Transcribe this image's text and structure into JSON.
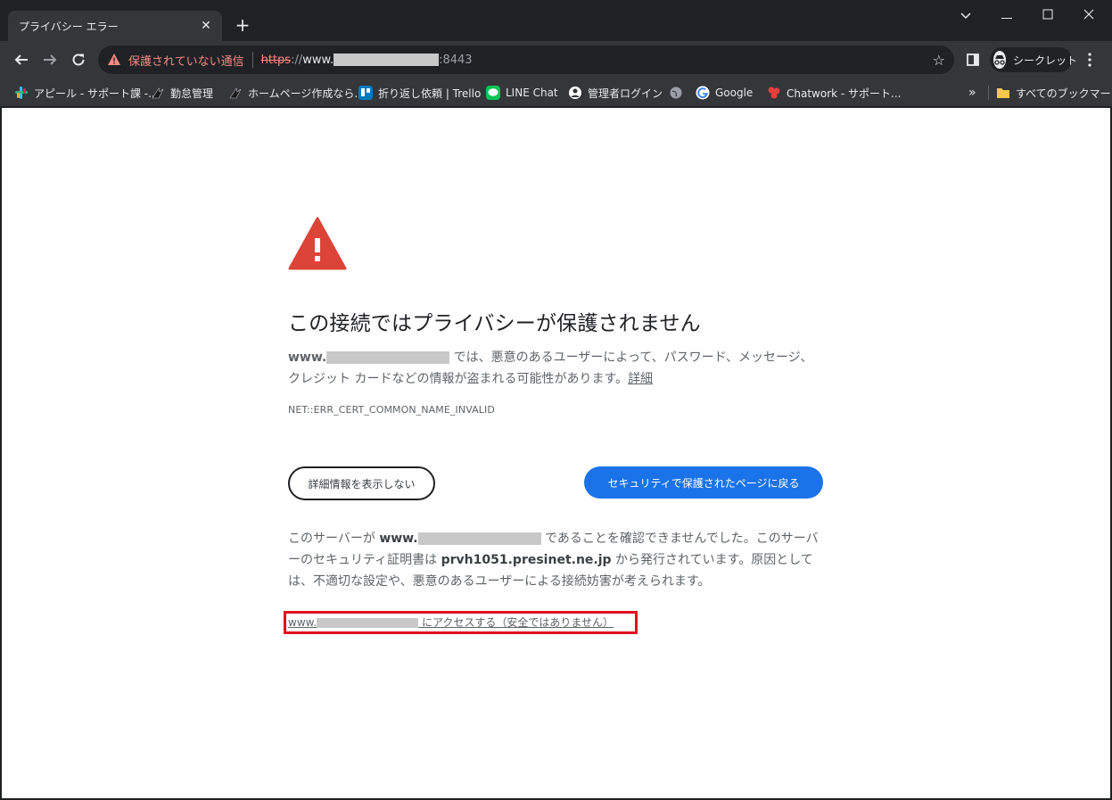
{
  "tab": {
    "title": "プライバシー エラー",
    "close": "✕",
    "new_tab": "+"
  },
  "window_controls": {
    "dropdown": "⌄",
    "minimize": "—",
    "maximize": "☐",
    "close": "✕"
  },
  "toolbar": {
    "security_label": "保護されていない通信",
    "url_scheme": "https",
    "url_separator": "://",
    "url_host": "www.",
    "url_port": ":8443",
    "incognito_label": "シークレット"
  },
  "bookmarks": [
    {
      "label": "アピール - サポート課 -...",
      "icon": "slack-icon",
      "color": "#e01e5a"
    },
    {
      "label": "勤怠管理",
      "icon": "ninja-icon",
      "color": "#35363a"
    },
    {
      "label": "ホームページ作成なら...",
      "icon": "ninja-icon",
      "color": "#35363a"
    },
    {
      "label": "折り返し依頼 | Trello",
      "icon": "trello-icon",
      "color": "#0079bf"
    },
    {
      "label": "LINE Chat",
      "icon": "line-icon",
      "color": "#06c755"
    },
    {
      "label": "管理者ログイン",
      "icon": "admin-icon",
      "color": "#ffffff"
    },
    {
      "label": "",
      "icon": "globe-icon",
      "color": "#9aa0a6"
    },
    {
      "label": "Google",
      "icon": "google-icon",
      "color": "#ffffff"
    },
    {
      "label": "Chatwork - サポート...",
      "icon": "chatwork-icon",
      "color": "#f03c3c"
    }
  ],
  "bookmarks_more": "»",
  "all_bookmarks": "すべてのブックマーク",
  "page": {
    "heading": "この接続ではプライバシーが保護されません",
    "msg_host_prefix": "www.",
    "msg_text": " では、悪意のあるユーザーによって、パスワード、メッセージ、クレジット カードなどの情報が盗まれる可能性があります。",
    "msg_link": "詳細",
    "error_code": "NET::ERR_CERT_COMMON_NAME_INVALID",
    "hide_details_button": "詳細情報を表示しない",
    "back_button": "セキュリティで保護されたページに戻る",
    "details_prefix": "このサーバーが ",
    "details_host": "www.",
    "details_mid": " であることを確認できませんでした。このサーバーのセキュリティ証明書は ",
    "details_issuer": "prvh1051.presinet.ne.jp",
    "details_suffix": " から発行されています。原因としては、不適切な設定や、悪意のあるユーザーによる接続妨害が考えられます。",
    "proceed_prefix": "www.",
    "proceed_suffix": " にアクセスする（安全ではありません）"
  },
  "colors": {
    "accent_blue": "#1a73e8",
    "warning_red": "#db4437",
    "highlight_red": "#e0101e"
  }
}
